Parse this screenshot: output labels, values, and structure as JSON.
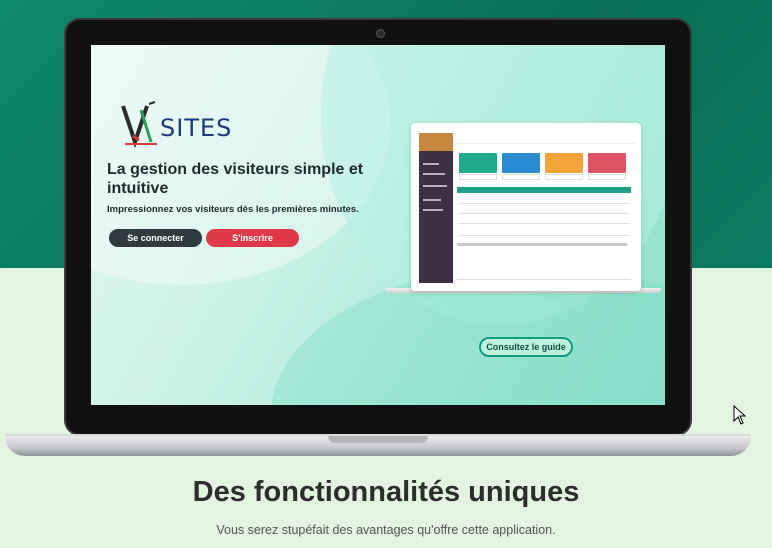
{
  "hero": {
    "logo_text": "SITES",
    "logo_letter": "V",
    "headline": "La gestion des visiteurs simple et intuitive",
    "subline": "Impressionnez vos visiteurs dès les premières minutes.",
    "login_label": "Se connecter",
    "signup_label": "S'inscrire",
    "guide_label": "Consultez le guide"
  },
  "features": {
    "title": "Des fonctionnalités uniques",
    "subtitle": "Vous serez stupéfait des avantages qu'offre cette application."
  },
  "colors": {
    "brand_dark": "#2f3b3e",
    "brand_red": "#e03a4a",
    "brand_teal": "#149b86",
    "tile_green": "#21a98d",
    "tile_blue": "#2a8ad1",
    "tile_orange": "#f0a43a",
    "tile_red": "#e05565"
  },
  "icons": [
    "pencil-logo-icon",
    "mouse-cursor-icon",
    "camera-icon"
  ]
}
